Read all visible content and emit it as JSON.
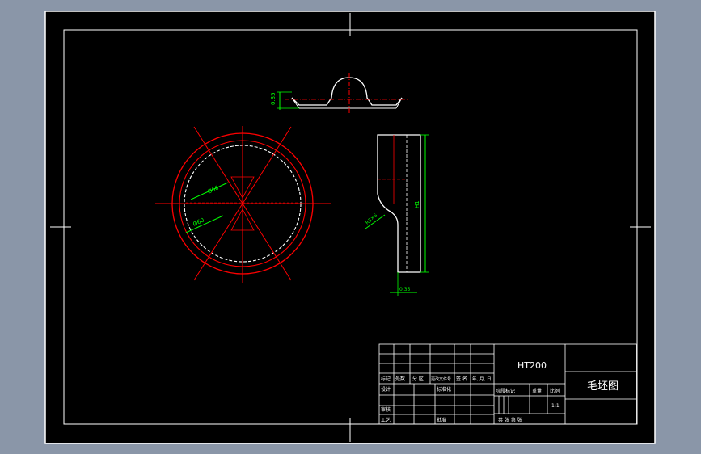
{
  "colors": {
    "workspace": "#8a96a8",
    "sheet": "#000000",
    "border": "#ffffff",
    "outline": "#ff0000",
    "dimension": "#00ff00",
    "hidden": "#ffffff"
  },
  "dims": {
    "top_thickness": "0.35",
    "diameter_1": "Ø66",
    "diameter_2": "Ø60",
    "radius": "R3×6",
    "height": "H1",
    "bottom": "0.35"
  },
  "title_block": {
    "material": "HT200",
    "drawing_name": "毛坯图",
    "scale": "1:1",
    "row_headers": [
      "标记",
      "处数",
      "分 区",
      "更改文件号",
      "签 名",
      "年, 月, 日"
    ],
    "design": "设计",
    "standardize": "标准化",
    "review": "审核",
    "process": "工艺",
    "approve": "批准",
    "stage_mark": "阶段标记",
    "weight": "重量",
    "ratio": "比例",
    "sheets": "共    张    第    张"
  }
}
